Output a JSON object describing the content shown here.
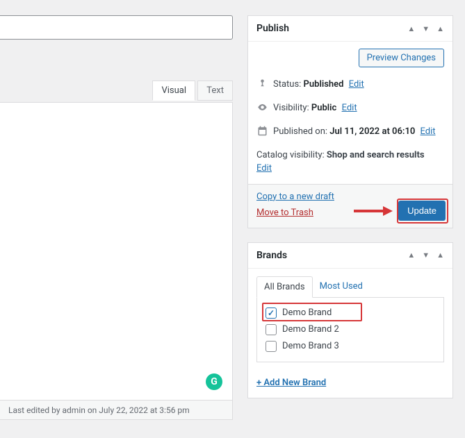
{
  "editor": {
    "tabs": {
      "visual": "Visual",
      "text": "Text"
    },
    "status_bar": "Last edited by admin on July 22, 2022 at 3:56 pm",
    "grammarly_badge": "G"
  },
  "publish": {
    "title": "Publish",
    "preview_button": "Preview Changes",
    "status_label": "Status: ",
    "status_value": "Published",
    "visibility_label": "Visibility: ",
    "visibility_value": "Public",
    "published_label": "Published on: ",
    "published_value": "Jul 11, 2022 at 06:10",
    "catalog_label": "Catalog visibility: ",
    "catalog_value": "Shop and search results",
    "edit_link": "Edit",
    "copy_draft": "Copy to a new draft",
    "move_trash": "Move to Trash",
    "update_button": "Update"
  },
  "brands": {
    "title": "Brands",
    "tabs": {
      "all": "All Brands",
      "most_used": "Most Used"
    },
    "items": [
      {
        "label": "Demo Brand",
        "checked": true
      },
      {
        "label": "Demo Brand 2",
        "checked": false
      },
      {
        "label": "Demo Brand 3",
        "checked": false
      }
    ],
    "add_new": "+ Add New Brand"
  }
}
